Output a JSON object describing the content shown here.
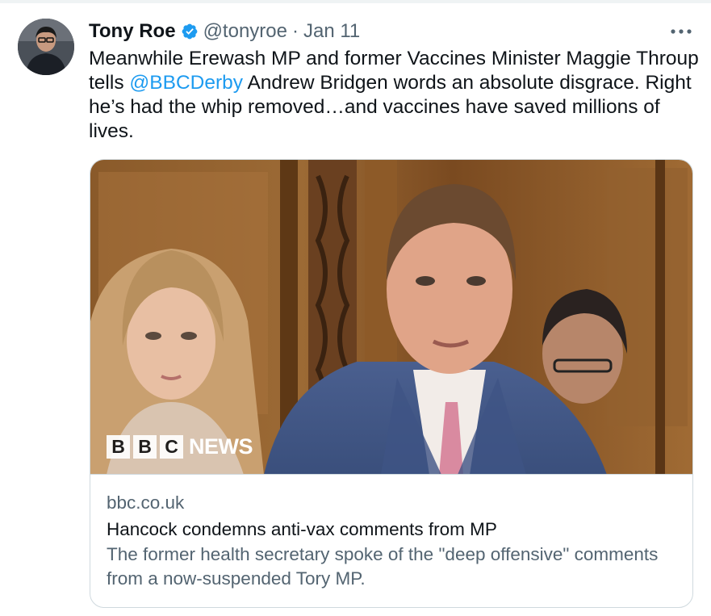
{
  "tweet": {
    "author_name": "Tony Roe",
    "handle": "@tonyroe",
    "separator": "·",
    "date": "Jan 11",
    "text_before": "Meanwhile Erewash MP and former Vaccines Minister Maggie Throup tells ",
    "mention": "@BBCDerby",
    "text_after": " Andrew Bridgen words an absolute disgrace. Right he’s had the whip removed…and vaccines have saved millions of lives."
  },
  "card": {
    "image_logo_letters": [
      "B",
      "B",
      "C"
    ],
    "image_logo_word": "NEWS",
    "domain": "bbc.co.uk",
    "title": "Hancock condemns anti-vax comments from MP",
    "description": "The former health secretary spoke of the \"deep offensive\" comments from a now-suspended Tory MP."
  },
  "icons": {
    "verified": "verified-badge-icon",
    "more": "more-options-icon"
  },
  "colors": {
    "accent": "#1d9bf0",
    "text": "#0f1419",
    "secondary": "#536471",
    "border": "#cfd9de"
  }
}
